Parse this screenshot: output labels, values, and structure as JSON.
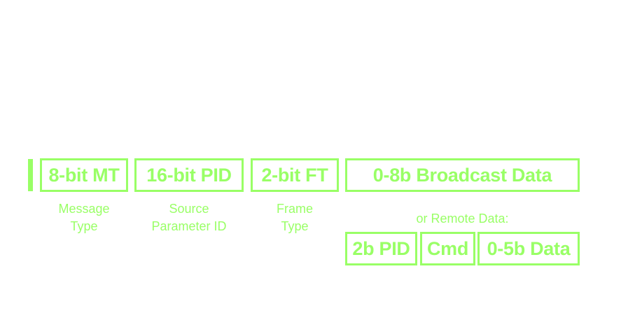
{
  "colors": {
    "accent": "#99ff66",
    "background": "#ffffff"
  },
  "fields": {
    "message_type": "8-bit MT",
    "source_pid": "16-bit PID",
    "frame_type": "2-bit FT",
    "broadcast_data": "0-8b Broadcast Data"
  },
  "captions": {
    "message_type": [
      "Message",
      "Type"
    ],
    "source_pid": [
      "Source",
      "Parameter ID"
    ],
    "frame_type": [
      "Frame",
      "Type"
    ]
  },
  "remote": {
    "label": "or Remote Data:",
    "fields": [
      "2b PID",
      "Cmd",
      "0-5b Data"
    ]
  }
}
